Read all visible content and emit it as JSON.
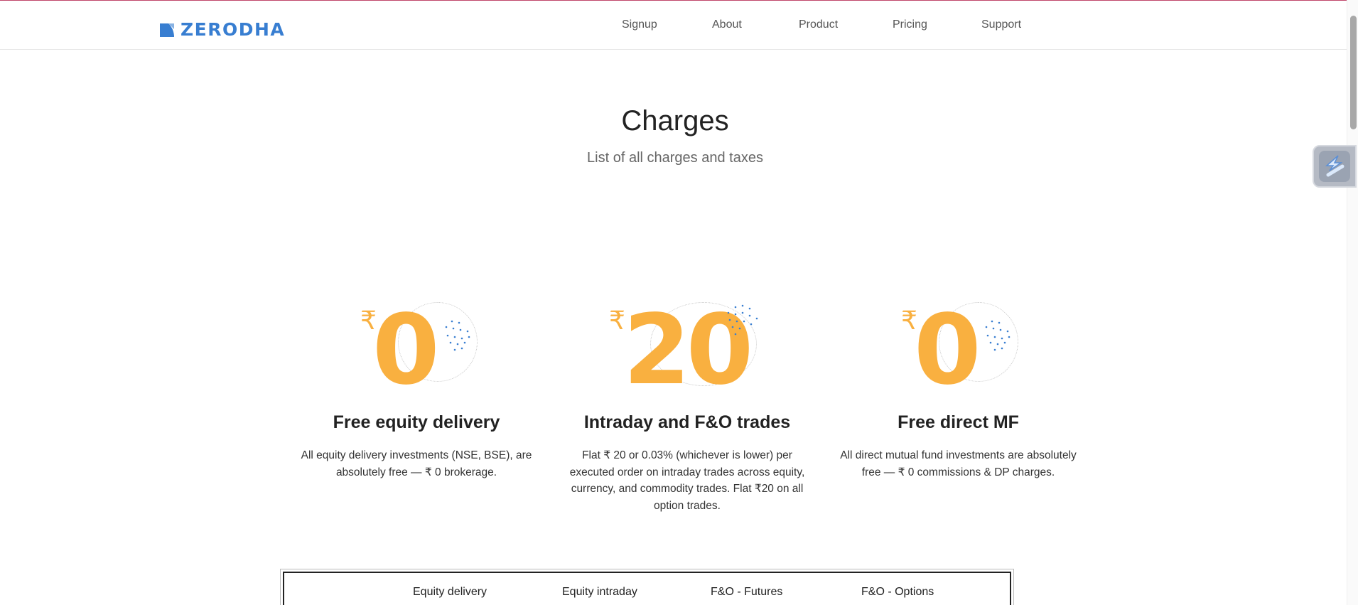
{
  "brand": {
    "name": "ZERODHA",
    "color": "#387ed1",
    "icon": "zerodha-logo-icon"
  },
  "nav": {
    "items": [
      {
        "label": "Signup"
      },
      {
        "label": "About"
      },
      {
        "label": "Product"
      },
      {
        "label": "Pricing"
      },
      {
        "label": "Support"
      }
    ]
  },
  "hero": {
    "title": "Charges",
    "subtitle": "List of all charges and taxes"
  },
  "cards": [
    {
      "currency": "₹",
      "amount": "0",
      "title": "Free equity delivery",
      "description": "All equity delivery investments (NSE, BSE), are absolutely free — ₹ 0 brokerage."
    },
    {
      "currency": "₹",
      "amount": "20",
      "title": "Intraday and F&O trades",
      "description": "Flat ₹ 20 or 0.03% (whichever is lower) per executed order on intraday trades across equity, currency, and commodity trades. Flat ₹20 on all option trades."
    },
    {
      "currency": "₹",
      "amount": "0",
      "title": "Free direct MF",
      "description": "All direct mutual fund investments are absolutely free — ₹ 0 commissions & DP charges."
    }
  ],
  "tabs": [
    {
      "label": "Equity delivery"
    },
    {
      "label": "Equity intraday"
    },
    {
      "label": "F&O - Futures"
    },
    {
      "label": "F&O - Options"
    }
  ],
  "colors": {
    "accent": "#f9b040",
    "dots": "#387ed1",
    "top_border": "#c0466b"
  },
  "widget": {
    "icon": "extension-widget-icon"
  }
}
